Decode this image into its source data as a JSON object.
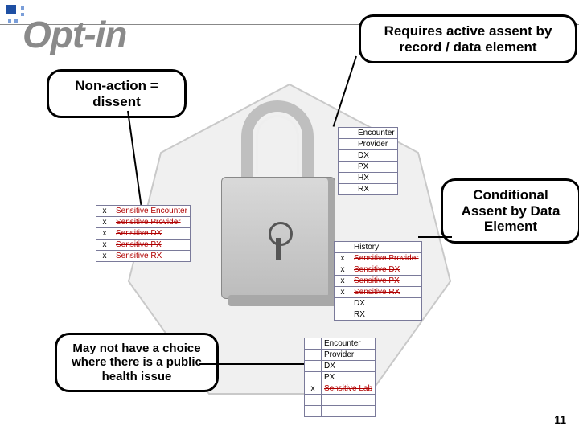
{
  "title": "Opt-in",
  "page_number": "11",
  "callouts": {
    "requires": "Requires active assent by record / data element",
    "nonaction": "Non-action = dissent",
    "conditional": "Conditional Assent by Data Element",
    "publichealth": "May not have a choice where there is a public health issue"
  },
  "tables": {
    "left_sensitive": [
      {
        "x": "x",
        "label": "Sensitive Encounter",
        "strike": true
      },
      {
        "x": "x",
        "label": "Sensitive Provider",
        "strike": true
      },
      {
        "x": "x",
        "label": "Sensitive DX",
        "strike": true
      },
      {
        "x": "x",
        "label": "Sensitive PX",
        "strike": true
      },
      {
        "x": "x",
        "label": "Sensitive RX",
        "strike": true
      }
    ],
    "top_right": [
      {
        "x": "",
        "label": "Encounter"
      },
      {
        "x": "",
        "label": "Provider"
      },
      {
        "x": "",
        "label": "DX"
      },
      {
        "x": "",
        "label": "PX"
      },
      {
        "x": "",
        "label": "HX"
      },
      {
        "x": "",
        "label": "RX"
      }
    ],
    "mid_right": [
      {
        "x": "",
        "label": "History"
      },
      {
        "x": "x",
        "label": "Sensitive Provider",
        "strike": true
      },
      {
        "x": "x",
        "label": "Sensitive DX",
        "strike": true
      },
      {
        "x": "x",
        "label": "Sensitive PX",
        "strike": true
      },
      {
        "x": "x",
        "label": "Sensitive RX",
        "strike": true
      },
      {
        "x": "",
        "label": "DX"
      },
      {
        "x": "",
        "label": "RX"
      }
    ],
    "bottom": [
      {
        "x": "",
        "label": "Encounter"
      },
      {
        "x": "",
        "label": "Provider"
      },
      {
        "x": "",
        "label": "DX"
      },
      {
        "x": "",
        "label": "PX"
      },
      {
        "x": "x",
        "label": "Sensitive Lab",
        "strike": true
      },
      {
        "x": "",
        "label": ""
      },
      {
        "x": "",
        "label": ""
      }
    ]
  }
}
